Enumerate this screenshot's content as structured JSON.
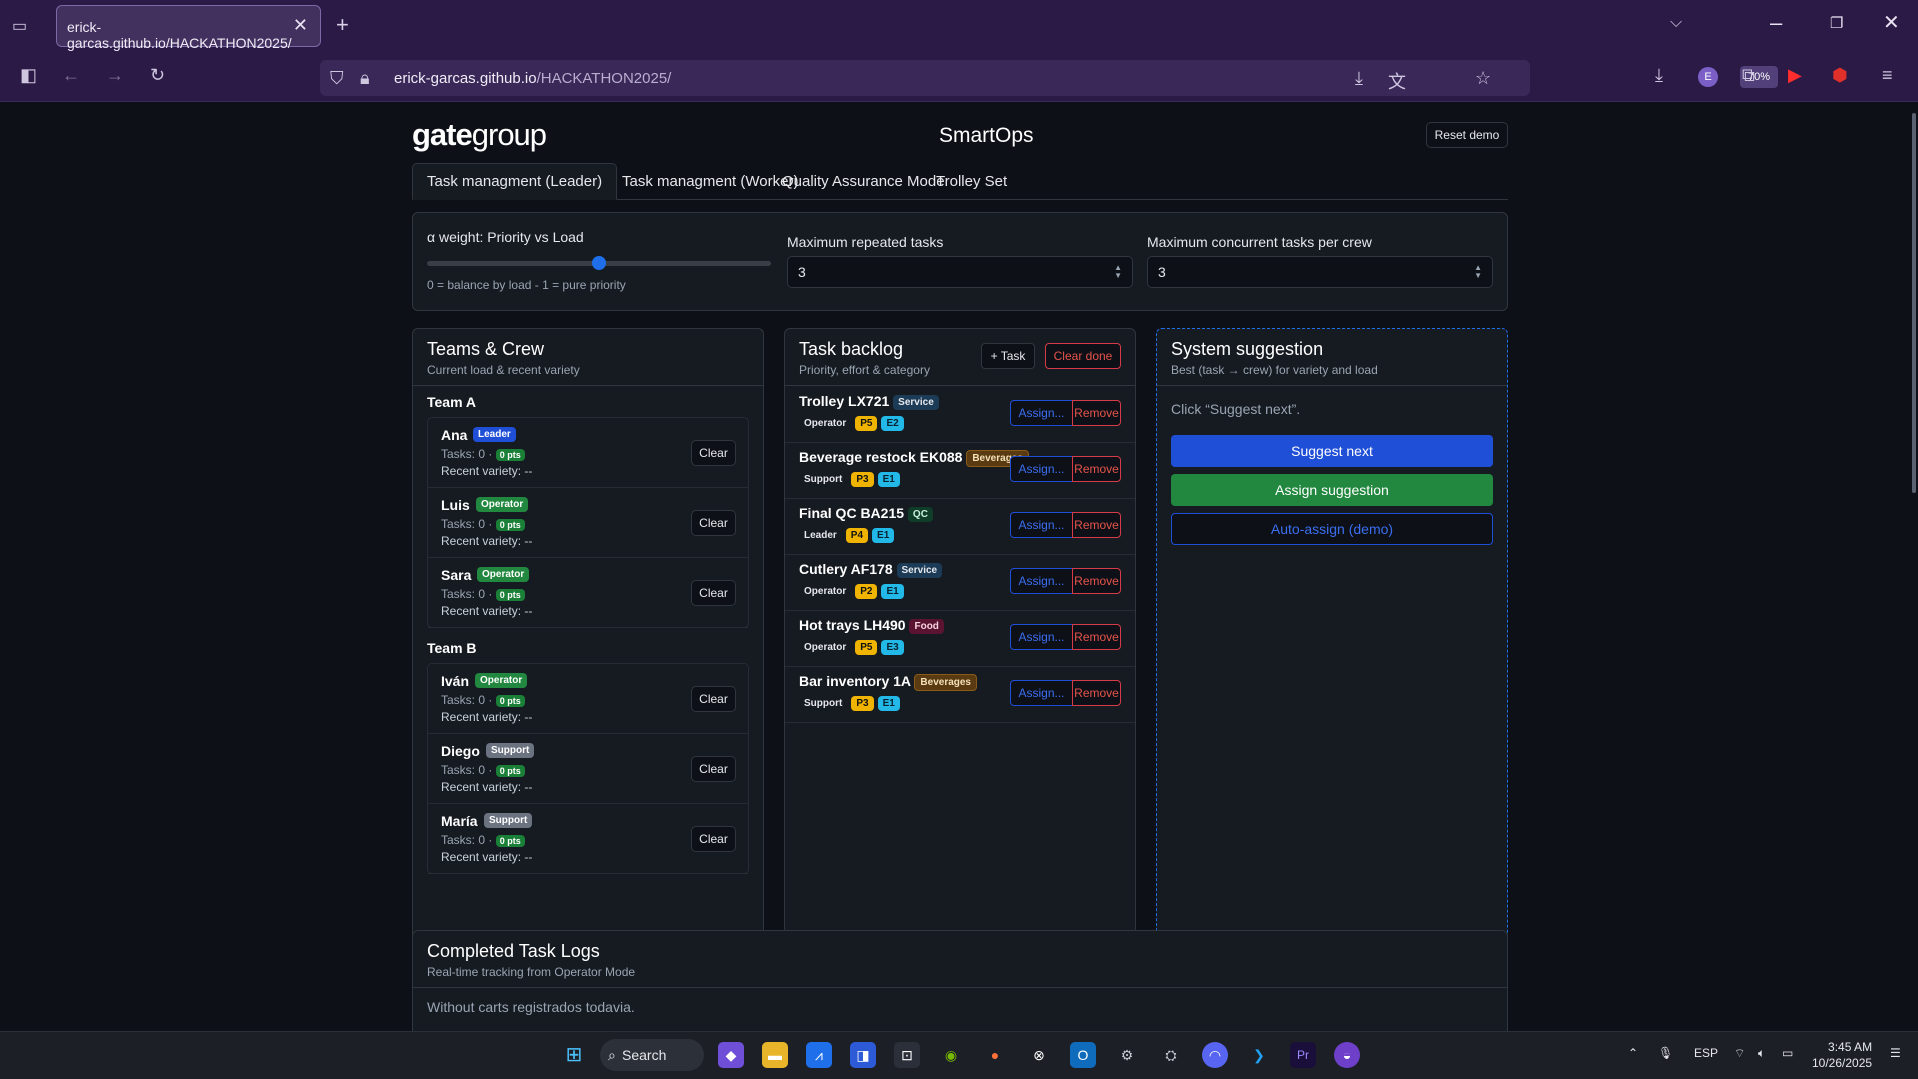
{
  "browser": {
    "tab_title": "erick-garcas.github.io/HACKATHON2025/",
    "url_host": "erick-garcas.github.io",
    "url_path": "/HACKATHON2025/",
    "zoom": "70%",
    "icons": [
      "tab-list-icon",
      "sidebar-icon",
      "back-icon",
      "forward-icon",
      "reload-icon",
      "shield-icon",
      "lock-icon",
      "download-page-icon",
      "translate-icon",
      "star-icon",
      "downloads-icon",
      "account-icon",
      "extensions-icon",
      "youtube-icon",
      "ublock-icon",
      "menu-icon"
    ]
  },
  "header": {
    "logo_bold": "gate",
    "logo_light": "group",
    "title": "SmartOps",
    "reset_label": "Reset demo"
  },
  "tabs": [
    "Task managment (Leader)",
    "Task managment (Worker)",
    "Quality Assurance Mode",
    "Trolley Set"
  ],
  "config": {
    "alpha_label": "α weight: Priority vs Load",
    "alpha_value": 0.5,
    "alpha_hint": "0 = balance by load - 1 = pure priority",
    "max_repeated_label": "Maximum repeated tasks",
    "max_repeated_value": "3",
    "max_concurrent_label": "Maximum concurrent tasks per crew",
    "max_concurrent_value": "3"
  },
  "teams": {
    "title": "Teams & Crew",
    "subtitle": "Current load & recent variety",
    "clear_label": "Clear",
    "tasks_text": "Tasks: 0 ·",
    "pts": "0 pts",
    "variety_label": "Recent variety:",
    "variety_value": "--",
    "groups": [
      {
        "name": "Team A",
        "members": [
          {
            "name": "Ana",
            "role": "Leader"
          },
          {
            "name": "Luis",
            "role": "Operator"
          },
          {
            "name": "Sara",
            "role": "Operator"
          }
        ]
      },
      {
        "name": "Team B",
        "members": [
          {
            "name": "Iván",
            "role": "Operator"
          },
          {
            "name": "Diego",
            "role": "Support"
          },
          {
            "name": "María",
            "role": "Support"
          }
        ]
      }
    ]
  },
  "backlog": {
    "title": "Task backlog",
    "subtitle": "Priority, effort & category",
    "add_label": "+ Task",
    "clear_done_label": "Clear done",
    "assign_label": "Assign...",
    "remove_label": "Remove",
    "tasks": [
      {
        "name": "Trolley LX721",
        "category": "Service",
        "role": "Operator",
        "priority": "P5",
        "effort": "E2"
      },
      {
        "name": "Beverage restock EK088",
        "category": "Beverages",
        "role": "Support",
        "priority": "P3",
        "effort": "E1"
      },
      {
        "name": "Final QC BA215",
        "category": "QC",
        "role": "Leader",
        "priority": "P4",
        "effort": "E1"
      },
      {
        "name": "Cutlery AF178",
        "category": "Service",
        "role": "Operator",
        "priority": "P2",
        "effort": "E1"
      },
      {
        "name": "Hot trays LH490",
        "category": "Food",
        "role": "Operator",
        "priority": "P5",
        "effort": "E3"
      },
      {
        "name": "Bar inventory 1A",
        "category": "Beverages",
        "role": "Support",
        "priority": "P3",
        "effort": "E1"
      }
    ]
  },
  "suggestion": {
    "title": "System suggestion",
    "subtitle": "Best (task → crew) for variety and load",
    "placeholder": "Click “Suggest next”.",
    "suggest_label": "Suggest next",
    "assign_label": "Assign suggestion",
    "auto_label": "Auto-assign (demo)"
  },
  "logs": {
    "title": "Completed Task Logs",
    "subtitle": "Real-time tracking from Operator Mode",
    "empty": "Without carts registrados todavia."
  },
  "taskbar": {
    "search_label": "Search",
    "lang": "ESP",
    "time": "3:45 AM",
    "date": "10/26/2025"
  },
  "colors": {
    "accent": "#1f4fd6",
    "success": "#22883f",
    "danger": "#d73a49",
    "background": "#0d1117",
    "panel": "#161b22"
  }
}
